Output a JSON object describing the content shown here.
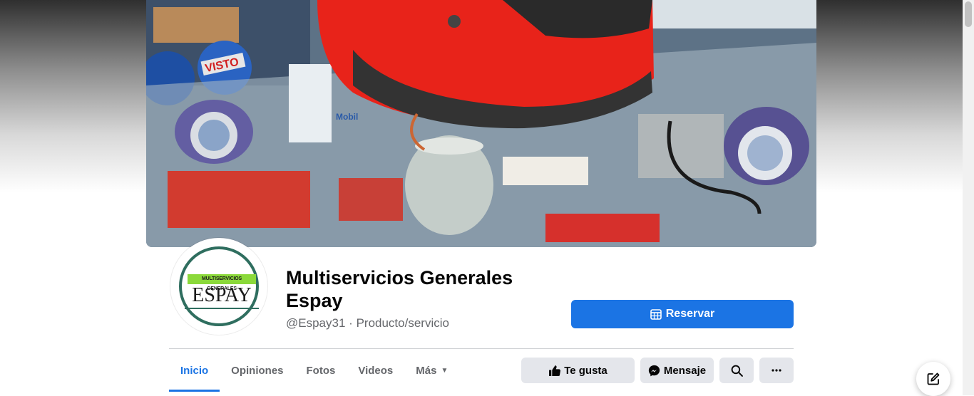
{
  "page": {
    "name": "Multiservicios Generales Espay",
    "handle": "@Espay31",
    "separator": "·",
    "category": "Producto/servicio"
  },
  "avatar": {
    "banner_text": "MULTISERVICIOS GENERALES",
    "name_text": "ESPAY"
  },
  "cover": {
    "brand_text_1": "VISTO",
    "brand_text_2": "Mobil"
  },
  "buttons": {
    "reserve": "Reservar",
    "like": "Te gusta",
    "message": "Mensaje"
  },
  "tabs": [
    {
      "label": "Inicio",
      "active": true
    },
    {
      "label": "Opiniones"
    },
    {
      "label": "Fotos"
    },
    {
      "label": "Videos"
    },
    {
      "label": "Más"
    }
  ],
  "icons": {
    "reserve": "calendar-icon",
    "like": "thumbs-up-icon",
    "message": "messenger-icon",
    "search": "search-icon",
    "more": "more-icon",
    "compose": "compose-icon"
  },
  "colors": {
    "accent": "#1b74e4",
    "secondary_button": "#e4e6eb",
    "text_primary": "#050505",
    "text_secondary": "#65676b"
  }
}
